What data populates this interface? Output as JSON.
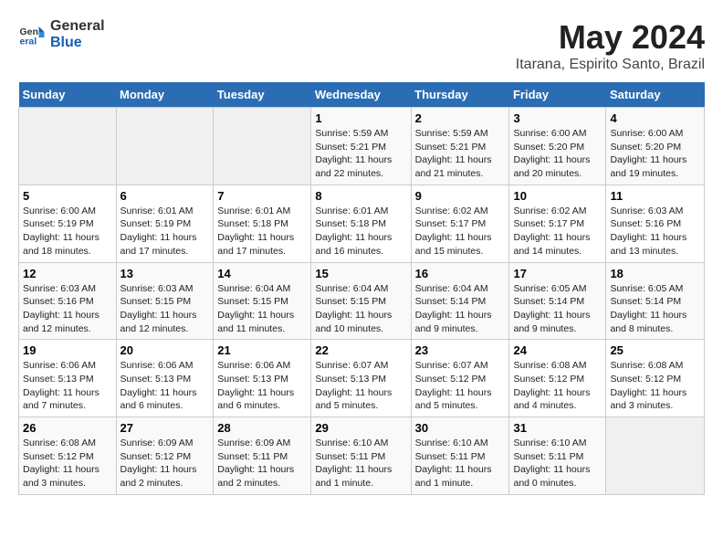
{
  "logo": {
    "general": "General",
    "blue": "Blue"
  },
  "title": "May 2024",
  "location": "Itarana, Espirito Santo, Brazil",
  "days_of_week": [
    "Sunday",
    "Monday",
    "Tuesday",
    "Wednesday",
    "Thursday",
    "Friday",
    "Saturday"
  ],
  "weeks": [
    [
      {
        "day": "",
        "info": ""
      },
      {
        "day": "",
        "info": ""
      },
      {
        "day": "",
        "info": ""
      },
      {
        "day": "1",
        "info": "Sunrise: 5:59 AM\nSunset: 5:21 PM\nDaylight: 11 hours and 22 minutes."
      },
      {
        "day": "2",
        "info": "Sunrise: 5:59 AM\nSunset: 5:21 PM\nDaylight: 11 hours and 21 minutes."
      },
      {
        "day": "3",
        "info": "Sunrise: 6:00 AM\nSunset: 5:20 PM\nDaylight: 11 hours and 20 minutes."
      },
      {
        "day": "4",
        "info": "Sunrise: 6:00 AM\nSunset: 5:20 PM\nDaylight: 11 hours and 19 minutes."
      }
    ],
    [
      {
        "day": "5",
        "info": "Sunrise: 6:00 AM\nSunset: 5:19 PM\nDaylight: 11 hours and 18 minutes."
      },
      {
        "day": "6",
        "info": "Sunrise: 6:01 AM\nSunset: 5:19 PM\nDaylight: 11 hours and 17 minutes."
      },
      {
        "day": "7",
        "info": "Sunrise: 6:01 AM\nSunset: 5:18 PM\nDaylight: 11 hours and 17 minutes."
      },
      {
        "day": "8",
        "info": "Sunrise: 6:01 AM\nSunset: 5:18 PM\nDaylight: 11 hours and 16 minutes."
      },
      {
        "day": "9",
        "info": "Sunrise: 6:02 AM\nSunset: 5:17 PM\nDaylight: 11 hours and 15 minutes."
      },
      {
        "day": "10",
        "info": "Sunrise: 6:02 AM\nSunset: 5:17 PM\nDaylight: 11 hours and 14 minutes."
      },
      {
        "day": "11",
        "info": "Sunrise: 6:03 AM\nSunset: 5:16 PM\nDaylight: 11 hours and 13 minutes."
      }
    ],
    [
      {
        "day": "12",
        "info": "Sunrise: 6:03 AM\nSunset: 5:16 PM\nDaylight: 11 hours and 12 minutes."
      },
      {
        "day": "13",
        "info": "Sunrise: 6:03 AM\nSunset: 5:15 PM\nDaylight: 11 hours and 12 minutes."
      },
      {
        "day": "14",
        "info": "Sunrise: 6:04 AM\nSunset: 5:15 PM\nDaylight: 11 hours and 11 minutes."
      },
      {
        "day": "15",
        "info": "Sunrise: 6:04 AM\nSunset: 5:15 PM\nDaylight: 11 hours and 10 minutes."
      },
      {
        "day": "16",
        "info": "Sunrise: 6:04 AM\nSunset: 5:14 PM\nDaylight: 11 hours and 9 minutes."
      },
      {
        "day": "17",
        "info": "Sunrise: 6:05 AM\nSunset: 5:14 PM\nDaylight: 11 hours and 9 minutes."
      },
      {
        "day": "18",
        "info": "Sunrise: 6:05 AM\nSunset: 5:14 PM\nDaylight: 11 hours and 8 minutes."
      }
    ],
    [
      {
        "day": "19",
        "info": "Sunrise: 6:06 AM\nSunset: 5:13 PM\nDaylight: 11 hours and 7 minutes."
      },
      {
        "day": "20",
        "info": "Sunrise: 6:06 AM\nSunset: 5:13 PM\nDaylight: 11 hours and 6 minutes."
      },
      {
        "day": "21",
        "info": "Sunrise: 6:06 AM\nSunset: 5:13 PM\nDaylight: 11 hours and 6 minutes."
      },
      {
        "day": "22",
        "info": "Sunrise: 6:07 AM\nSunset: 5:13 PM\nDaylight: 11 hours and 5 minutes."
      },
      {
        "day": "23",
        "info": "Sunrise: 6:07 AM\nSunset: 5:12 PM\nDaylight: 11 hours and 5 minutes."
      },
      {
        "day": "24",
        "info": "Sunrise: 6:08 AM\nSunset: 5:12 PM\nDaylight: 11 hours and 4 minutes."
      },
      {
        "day": "25",
        "info": "Sunrise: 6:08 AM\nSunset: 5:12 PM\nDaylight: 11 hours and 3 minutes."
      }
    ],
    [
      {
        "day": "26",
        "info": "Sunrise: 6:08 AM\nSunset: 5:12 PM\nDaylight: 11 hours and 3 minutes."
      },
      {
        "day": "27",
        "info": "Sunrise: 6:09 AM\nSunset: 5:12 PM\nDaylight: 11 hours and 2 minutes."
      },
      {
        "day": "28",
        "info": "Sunrise: 6:09 AM\nSunset: 5:11 PM\nDaylight: 11 hours and 2 minutes."
      },
      {
        "day": "29",
        "info": "Sunrise: 6:10 AM\nSunset: 5:11 PM\nDaylight: 11 hours and 1 minute."
      },
      {
        "day": "30",
        "info": "Sunrise: 6:10 AM\nSunset: 5:11 PM\nDaylight: 11 hours and 1 minute."
      },
      {
        "day": "31",
        "info": "Sunrise: 6:10 AM\nSunset: 5:11 PM\nDaylight: 11 hours and 0 minutes."
      },
      {
        "day": "",
        "info": ""
      }
    ]
  ]
}
